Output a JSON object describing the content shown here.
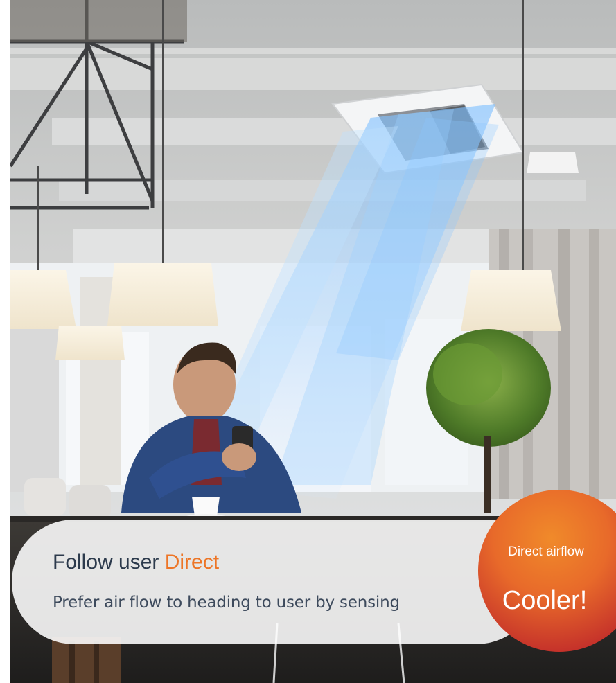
{
  "headline": {
    "prefix": "Follow user ",
    "accent": "Direct"
  },
  "subline": "Prefer air flow to heading to user by sensing",
  "badge": {
    "top": "Direct airflow",
    "main": "Cooler!"
  },
  "colors": {
    "accent": "#ed7526",
    "text_dark": "#2c3a4c",
    "badge_orange": "#f08a2a",
    "badge_red": "#b0202a",
    "airflow_blue": "#5ea8f0"
  }
}
